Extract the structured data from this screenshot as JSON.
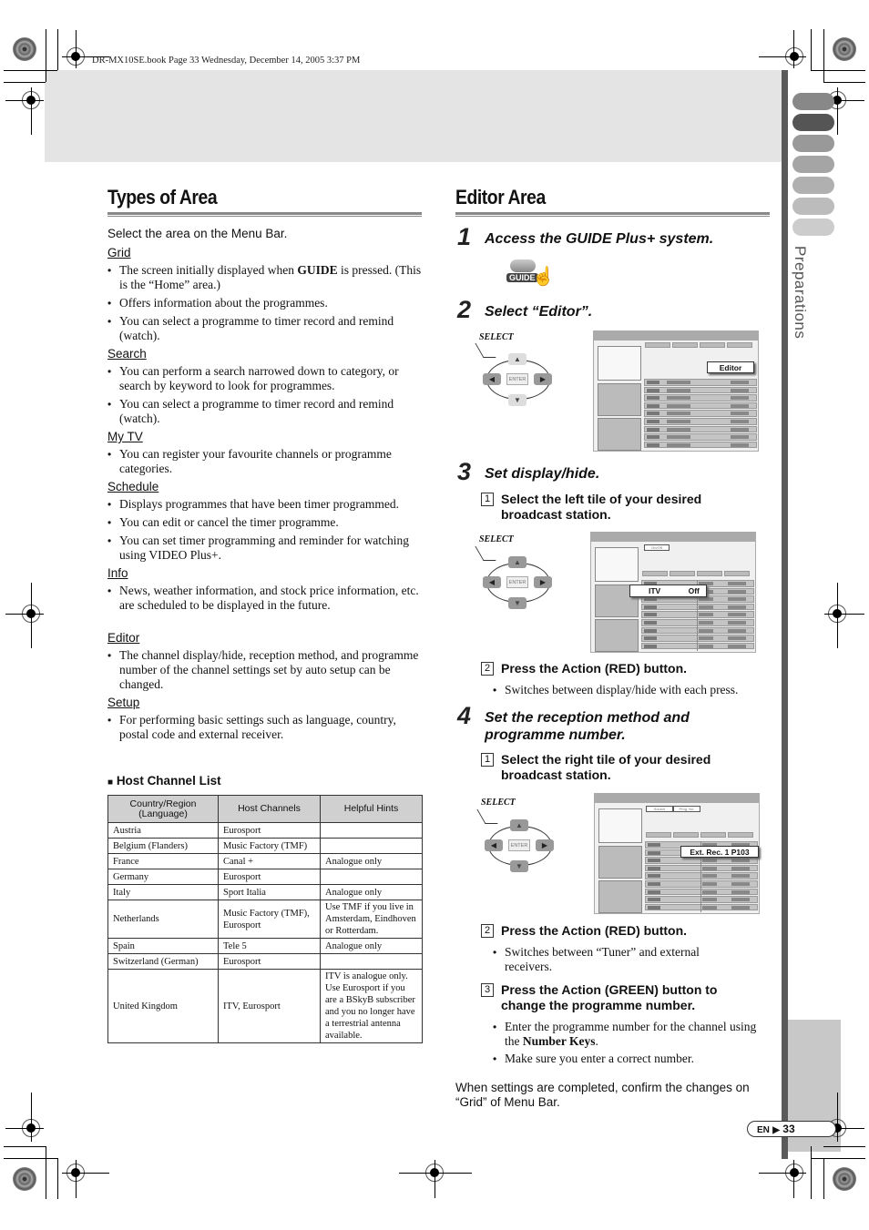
{
  "header": {
    "book_info": "DR-MX10SE.book  Page 33  Wednesday, December 14, 2005  3:37 PM"
  },
  "sidebar": {
    "section_label": "Preparations",
    "tab_colors": [
      "#888888",
      "#555555",
      "#999999",
      "#a5a5a5",
      "#b0b0b0",
      "#bcbcbc",
      "#cccccc"
    ]
  },
  "left": {
    "title": "Types of Area",
    "intro": "Select the area on the Menu Bar.",
    "areas": [
      {
        "name": "Grid",
        "bullets": [
          "The screen initially displayed when GUIDE is pressed. (This is the “Home” area.)",
          "Offers information about the programmes.",
          "You can select a programme to timer record and remind (watch)."
        ]
      },
      {
        "name": "Search",
        "bullets": [
          "You can perform a search narrowed down to category, or search by keyword to look for programmes.",
          "You can select a programme to timer record and remind (watch)."
        ]
      },
      {
        "name": "My TV",
        "bullets": [
          "You can register your favourite channels or programme categories."
        ]
      },
      {
        "name": "Schedule",
        "bullets": [
          "Displays programmes that have been timer programmed.",
          "You can edit or cancel the timer programme.",
          "You can set timer programming and reminder for watching using VIDEO Plus+."
        ]
      },
      {
        "name": "Info",
        "bullets": [
          "News, weather information, and stock price information, etc. are scheduled to be displayed in the future."
        ]
      },
      {
        "name": "Editor",
        "bullets": [
          "The channel display/hide, reception method, and programme number of the channel settings set by auto setup can be changed."
        ]
      },
      {
        "name": "Setup",
        "bullets": [
          "For performing basic settings such as language, country, postal code and external receiver."
        ]
      }
    ],
    "grid_bullet_parts": {
      "before": "The screen initially displayed when ",
      "bold": "GUIDE",
      "after": " is pressed. (This is the “Home” area.)"
    },
    "host_list_title": "Host Channel List",
    "table": {
      "headers": [
        "Country/Region (Language)",
        "Host Channels",
        "Helpful Hints"
      ],
      "rows": [
        [
          "Austria",
          "Eurosport",
          ""
        ],
        [
          "Belgium (Flanders)",
          "Music Factory (TMF)",
          ""
        ],
        [
          "France",
          "Canal +",
          "Analogue only"
        ],
        [
          "Germany",
          "Eurosport",
          ""
        ],
        [
          "Italy",
          "Sport Italia",
          "Analogue only"
        ],
        [
          "Netherlands",
          "Music Factory (TMF), Eurosport",
          "Use TMF if you live in Amsterdam, Eindhoven or Rotterdam."
        ],
        [
          "Spain",
          "Tele 5",
          "Analogue only"
        ],
        [
          "Switzerland (German)",
          "Eurosport",
          ""
        ],
        [
          "United Kingdom",
          "ITV, Eurosport",
          "ITV is analogue only. Use Eurosport if you are a BSkyB subscriber and you no longer have a terrestrial antenna available."
        ]
      ]
    }
  },
  "right": {
    "title": "Editor Area",
    "steps": [
      {
        "num": "1",
        "title": "Access the GUIDE Plus+ system.",
        "button_label": "GUIDE"
      },
      {
        "num": "2",
        "title": "Select “Editor”.",
        "select_label": "SELECT",
        "enter_label": "ENTER",
        "popup": "Editor"
      },
      {
        "num": "3",
        "title": "Set display/hide.",
        "substeps": [
          {
            "num": "1",
            "text": "Select the left tile of your desired broadcast station."
          },
          {
            "num": "2",
            "text": "Press the Action (RED) button.",
            "bullets": [
              "Switches between display/hide with each press."
            ]
          }
        ],
        "select_label": "SELECT",
        "enter_label": "ENTER",
        "popup_channel": "ITV",
        "popup_state": "Off",
        "screen_tab": "On/Off"
      },
      {
        "num": "4",
        "title": "Set the reception method and programme number.",
        "substeps": [
          {
            "num": "1",
            "text": "Select the right tile of your desired broadcast station."
          },
          {
            "num": "2",
            "text": "Press the Action (RED) button.",
            "bullets": [
              "Switches between “Tuner” and external receivers."
            ]
          },
          {
            "num": "3",
            "text": "Press the Action (GREEN) button to change the programme number.",
            "bullets": [
              "Enter the programme number for the channel using the Number Keys.",
              "Make sure you enter a correct number."
            ]
          }
        ],
        "select_label": "SELECT",
        "enter_label": "ENTER",
        "popup": "Ext. Rec. 1 P103",
        "screen_tabs": [
          "Source",
          "Prog. No."
        ]
      }
    ],
    "number_keys_parts": {
      "before": "Enter the programme number for the channel using the ",
      "bold": "Number Keys",
      "after": "."
    },
    "closing": "When settings are completed, confirm the changes on “Grid” of Menu Bar."
  },
  "footer": {
    "lang": "EN",
    "page": "33"
  }
}
